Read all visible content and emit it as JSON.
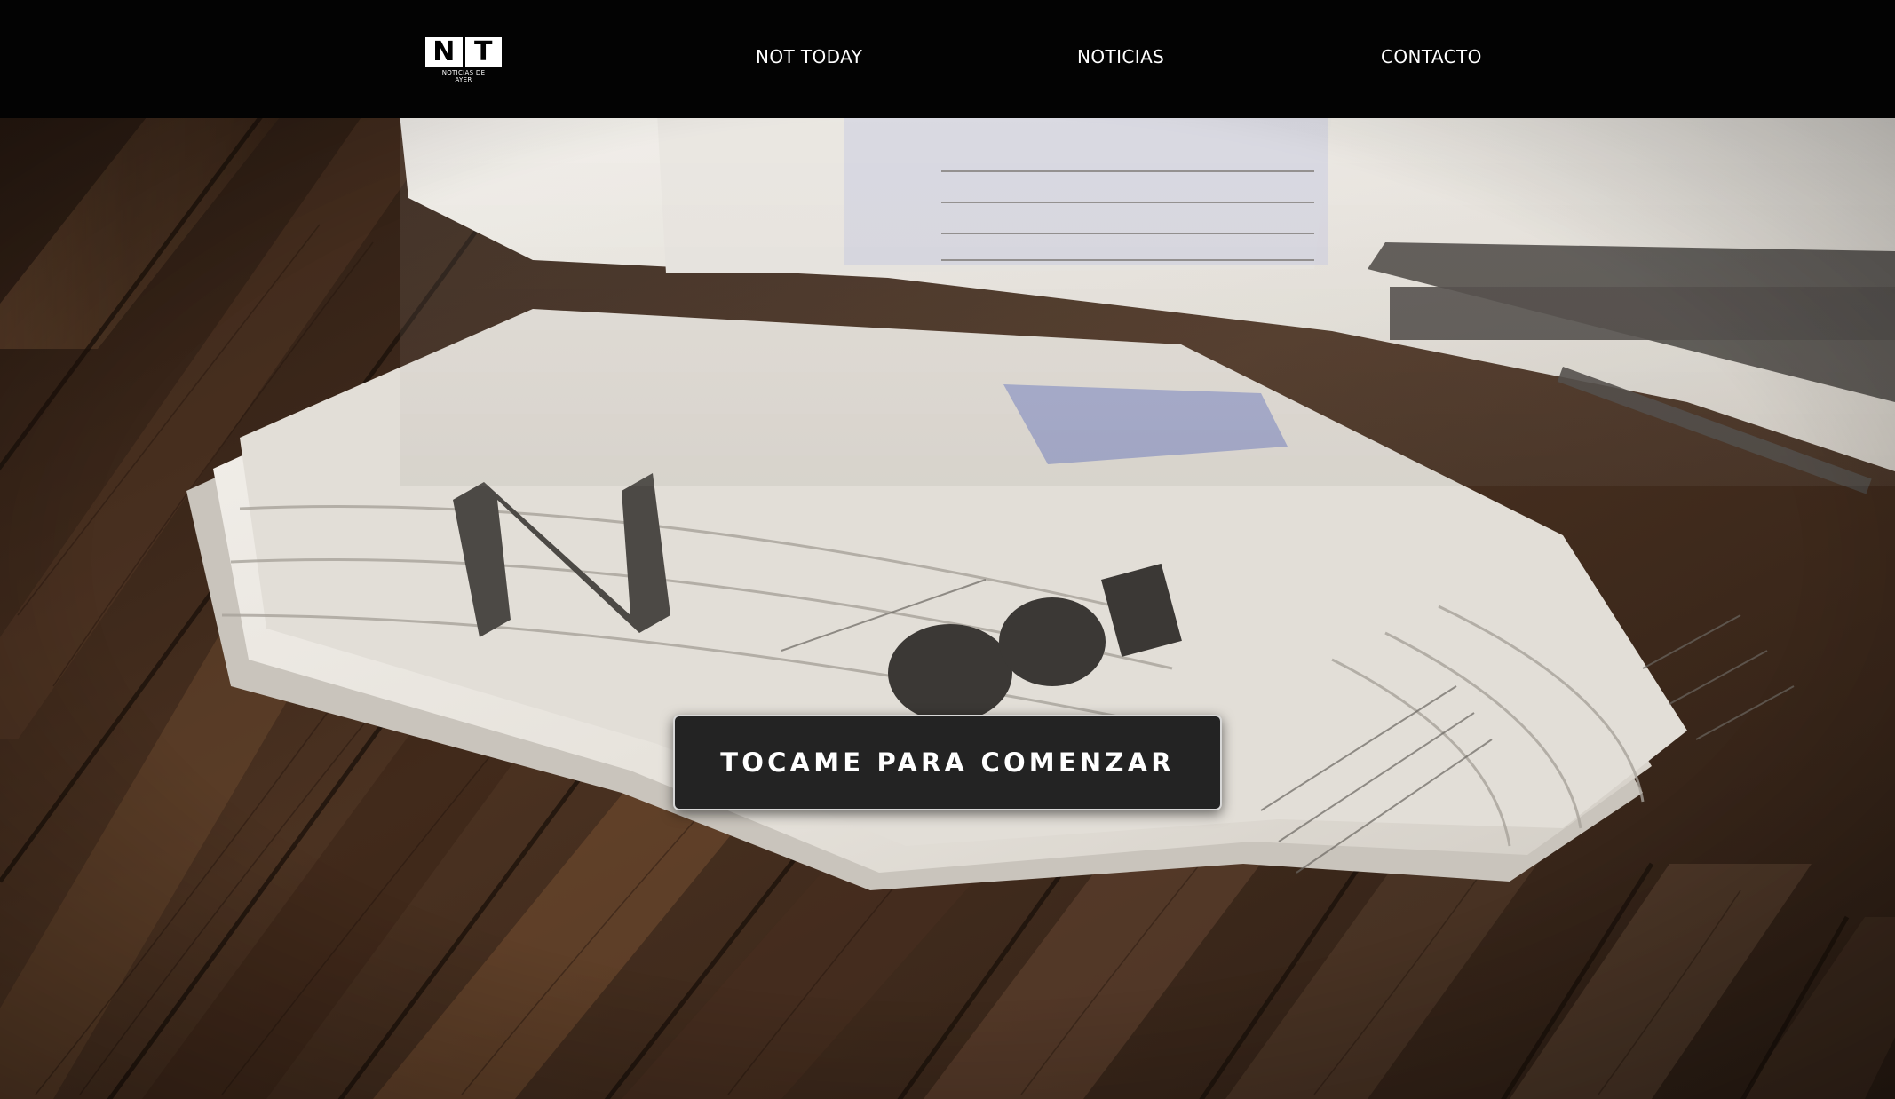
{
  "navbar": {
    "logo": {
      "letters": [
        "N",
        "T"
      ],
      "tagline": "NOTICIAS DE\nAYER"
    },
    "links": [
      {
        "label": "NOT TODAY"
      },
      {
        "label": "NOTICIAS"
      },
      {
        "label": "CONTACTO"
      }
    ]
  },
  "hero": {
    "background_image": "newspapers-on-wooden-table",
    "cta_label": "TOCAME PARA COMENZAR"
  },
  "colors": {
    "navbar_bg": "#030303",
    "nav_text": "#ffffff",
    "cta_bg": "#232323",
    "cta_border": "#d8d8d8",
    "wood_dark": "#2e1e14",
    "wood_light": "#6b4a33",
    "paper": "#e9e6e0"
  }
}
